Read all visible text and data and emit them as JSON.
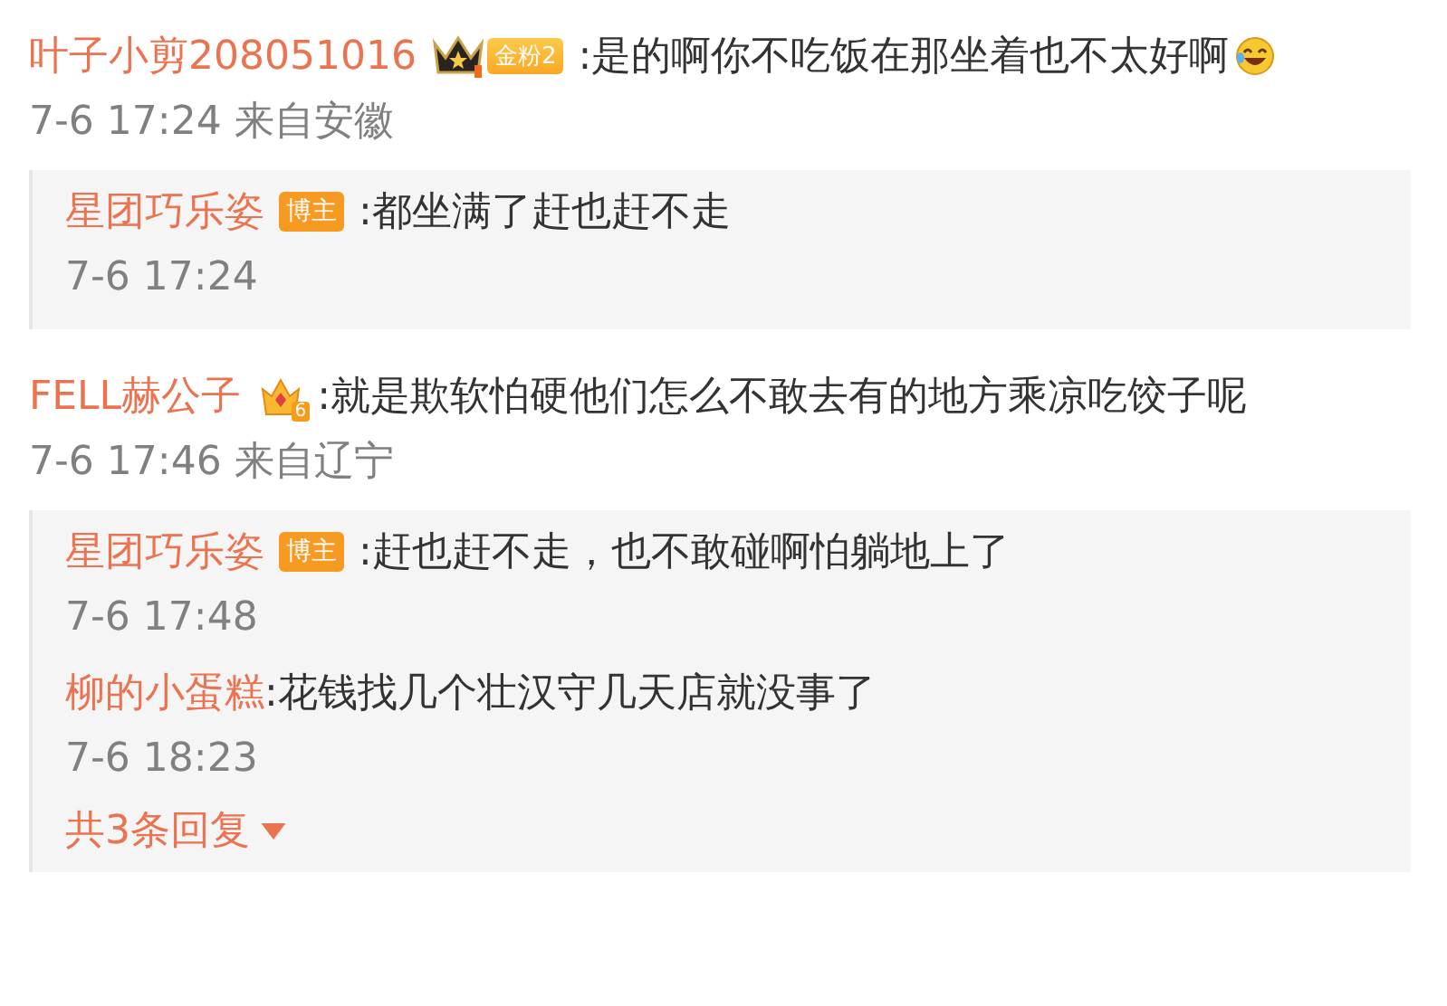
{
  "comments": [
    {
      "author": "叶子小剪208051016",
      "badge": {
        "kind": "crown-fan",
        "label": "金粉2"
      },
      "text": ":是的啊你不吃饭在那坐着也不太好啊",
      "emoji": true,
      "time": "7-6 17:24 来自安徽",
      "replies": [
        {
          "author": "星团巧乐姿",
          "tag": "博主",
          "text": ":都坐满了赶也赶不走",
          "time": "7-6 17:24"
        }
      ]
    },
    {
      "author": "FELL赫公子",
      "badge": {
        "kind": "crown-level",
        "label": "6"
      },
      "text": ":就是欺软怕硬他们怎么不敢去有的地方乘凉吃饺子呢",
      "emoji": false,
      "time": "7-6 17:46 来自辽宁",
      "replies": [
        {
          "author": "星团巧乐姿",
          "tag": "博主",
          "text": ":赶也赶不走，也不敢碰啊怕躺地上了",
          "time": "7-6 17:48"
        },
        {
          "author": "柳的小蛋糕",
          "text": ":花钱找几个壮汉守几天店就没事了",
          "time": "7-6 18:23"
        }
      ],
      "more": "共3条回复"
    }
  ]
}
